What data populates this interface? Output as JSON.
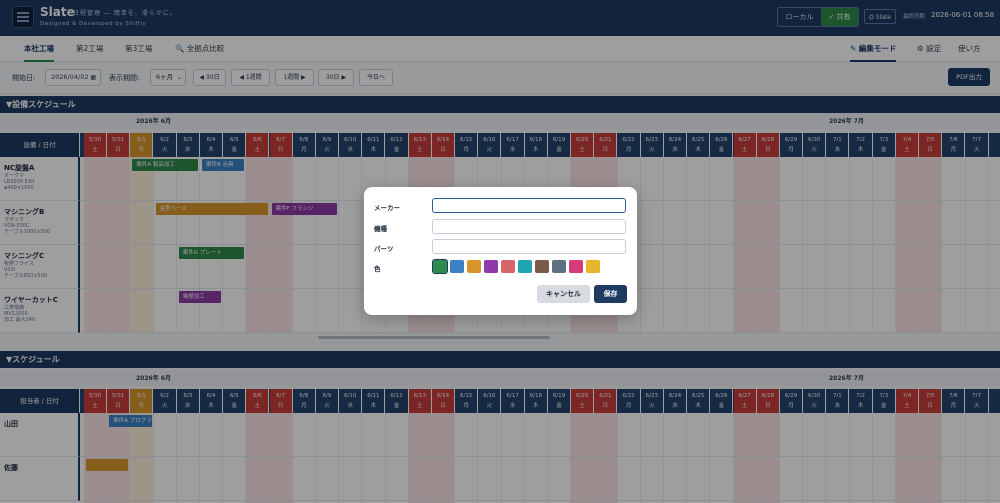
{
  "app": {
    "name": "Slate",
    "tagline": "日程管理 — 簡単を、滑らかに。",
    "credit": "Designed & Developed by Shiftly",
    "mode_local": "ローカル",
    "mode_shared": "✓ 共有",
    "slate_button": "⛭ Slate",
    "sync_label": "最終同期",
    "sync_time": "2026-06-01 08:58"
  },
  "tabs": {
    "left": [
      "本社工場",
      "第2工場",
      "第3工場",
      "🔍 全拠点比較"
    ],
    "active_left": 0,
    "right": [
      "✎ 編集モード",
      "⚙ 設定",
      "使い方"
    ],
    "active_right": 0
  },
  "toolbar": {
    "start_label": "開始日:",
    "start_value": "2026/04/02",
    "calendar_icon": "calendar-icon",
    "period_label": "表示期間:",
    "period_value": "6ヶ月",
    "btn_back30": "◀ 30日",
    "btn_back1w": "◀ 1週間",
    "btn_fwd1w": "1週間 ▶",
    "btn_fwd30": "30日 ▶",
    "btn_today": "今日へ",
    "pdf": "PDF出力"
  },
  "calendar": {
    "month1": "2026年 6月",
    "month2": "2026年 7月",
    "days": [
      {
        "d": "5/30",
        "w": "土",
        "t": "holiday"
      },
      {
        "d": "5/31",
        "w": "日",
        "t": "holiday"
      },
      {
        "d": "6/1",
        "w": "月",
        "t": "today"
      },
      {
        "d": "6/2",
        "w": "火",
        "t": ""
      },
      {
        "d": "6/3",
        "w": "水",
        "t": ""
      },
      {
        "d": "6/4",
        "w": "木",
        "t": ""
      },
      {
        "d": "6/5",
        "w": "金",
        "t": ""
      },
      {
        "d": "6/6",
        "w": "土",
        "t": "holiday"
      },
      {
        "d": "6/7",
        "w": "日",
        "t": "holiday"
      },
      {
        "d": "6/8",
        "w": "月",
        "t": ""
      },
      {
        "d": "6/9",
        "w": "火",
        "t": ""
      },
      {
        "d": "6/10",
        "w": "水",
        "t": ""
      },
      {
        "d": "6/11",
        "w": "木",
        "t": ""
      },
      {
        "d": "6/12",
        "w": "金",
        "t": ""
      },
      {
        "d": "6/13",
        "w": "土",
        "t": "holiday"
      },
      {
        "d": "6/14",
        "w": "日",
        "t": "holiday"
      },
      {
        "d": "6/15",
        "w": "月",
        "t": ""
      },
      {
        "d": "6/16",
        "w": "火",
        "t": ""
      },
      {
        "d": "6/17",
        "w": "水",
        "t": ""
      },
      {
        "d": "6/18",
        "w": "木",
        "t": ""
      },
      {
        "d": "6/19",
        "w": "金",
        "t": ""
      },
      {
        "d": "6/20",
        "w": "土",
        "t": "holiday"
      },
      {
        "d": "6/21",
        "w": "日",
        "t": "holiday"
      },
      {
        "d": "6/22",
        "w": "月",
        "t": ""
      },
      {
        "d": "6/23",
        "w": "火",
        "t": ""
      },
      {
        "d": "6/24",
        "w": "水",
        "t": ""
      },
      {
        "d": "6/25",
        "w": "木",
        "t": ""
      },
      {
        "d": "6/26",
        "w": "金",
        "t": ""
      },
      {
        "d": "6/27",
        "w": "土",
        "t": "holiday"
      },
      {
        "d": "6/28",
        "w": "日",
        "t": "holiday"
      },
      {
        "d": "6/29",
        "w": "月",
        "t": ""
      },
      {
        "d": "6/30",
        "w": "火",
        "t": ""
      },
      {
        "d": "7/1",
        "w": "水",
        "t": ""
      },
      {
        "d": "7/2",
        "w": "木",
        "t": ""
      },
      {
        "d": "7/3",
        "w": "金",
        "t": ""
      },
      {
        "d": "7/4",
        "w": "土",
        "t": "holiday"
      },
      {
        "d": "7/5",
        "w": "日",
        "t": "holiday"
      },
      {
        "d": "7/6",
        "w": "月",
        "t": ""
      },
      {
        "d": "7/7",
        "w": "火",
        "t": ""
      }
    ]
  },
  "equipment_section": {
    "title": "▼設備スケジュール",
    "corner": "設備 / 日付",
    "rows": [
      {
        "name": "NC旋盤A",
        "sub": [
          "オークマ",
          "LB3000 EXII",
          "φ400×1000"
        ]
      },
      {
        "name": "マシニングB",
        "sub": [
          "マザック",
          "VCN-530C",
          "テーブル1000×500"
        ]
      },
      {
        "name": "マシニングC",
        "sub": [
          "牧野フライス",
          "V33i",
          "テーブル650×500"
        ]
      },
      {
        "name": "ワイヤーカットC",
        "sub": [
          "三菱電機",
          "MV1200R",
          "加工 最大240"
        ]
      }
    ],
    "jobs": [
      {
        "label": "案件A 製品加工",
        "row": 0,
        "start": 2,
        "span": 3,
        "color": "#2f8a4c"
      },
      {
        "label": "案件B 治具",
        "row": 0,
        "start": 5,
        "span": 2,
        "color": "#3b82c4"
      },
      {
        "label": "金型ベース",
        "row": 1,
        "start": 3,
        "span": 5,
        "color": "#d8962a"
      },
      {
        "label": "案件F フランジ",
        "row": 1,
        "start": 8,
        "span": 3,
        "color": "#8e3aa8"
      },
      {
        "label": "案件G プレート",
        "row": 2,
        "start": 4,
        "span": 3,
        "color": "#2f8a4c"
      },
      {
        "label": "電極加工",
        "row": 3,
        "start": 4,
        "span": 2,
        "color": "#8e3aa8"
      }
    ]
  },
  "staff_section": {
    "title": "▼スケジュール",
    "corner": "担当者 / 日付",
    "rows": [
      {
        "name": "山田"
      },
      {
        "name": "佐藤"
      }
    ],
    "jobs": [
      {
        "label": "案件A プログラム",
        "row": 0,
        "start": 1,
        "span": 2,
        "color": "#3b82c4"
      },
      {
        "label": "",
        "row": 1,
        "start": 0,
        "span": 2,
        "color": "#d8962a"
      }
    ]
  },
  "modal": {
    "maker_label": "メーカー",
    "maker_value": "",
    "model_label": "機種",
    "model_value": "",
    "parts_label": "パーツ",
    "parts_value": "",
    "color_label": "色",
    "colors": [
      "#2f8a4c",
      "#3b82c4",
      "#d8962a",
      "#8e3aa8",
      "#d9646a",
      "#1fa5b0",
      "#7a5a48",
      "#5f6f82",
      "#d63a78",
      "#e8b42c"
    ],
    "selected_color": 0,
    "cancel": "キャンセル",
    "save": "保存"
  }
}
